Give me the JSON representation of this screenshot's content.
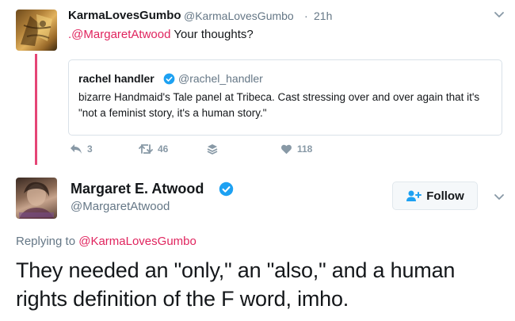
{
  "tweet1": {
    "name": "KarmaLovesGumbo",
    "handle": "@KarmaLovesGumbo",
    "separator": "·",
    "time": "21h",
    "text_prefix": ".",
    "mention": "@MargaretAtwood",
    "text": " Your thoughts?",
    "avatar_icon": "avatar-image",
    "quoted": {
      "name": "rachel handler",
      "handle": "@rachel_handler",
      "verified": true,
      "text": "bizarre Handmaid's Tale panel at Tribeca. Cast stressing over and over again that it's \"not a feminist story, it's a human story.\""
    },
    "actions": {
      "reply_count": "3",
      "retweet_count": "46",
      "like_count": "118"
    }
  },
  "tweet2": {
    "name": "Margaret E. Atwood",
    "verified": true,
    "handle": "@MargaretAtwood",
    "follow_label": "Follow",
    "replying_prefix": "Replying to ",
    "replying_to": "@KarmaLovesGumbo",
    "text": "They needed an \"only,\" an \"also,\" and a human rights definition of the F word, imho."
  },
  "colors": {
    "accent": "#e0245e",
    "verified": "#1da1f2",
    "muted": "#657786",
    "action_gray": "#8899a6",
    "text": "#14171a"
  }
}
